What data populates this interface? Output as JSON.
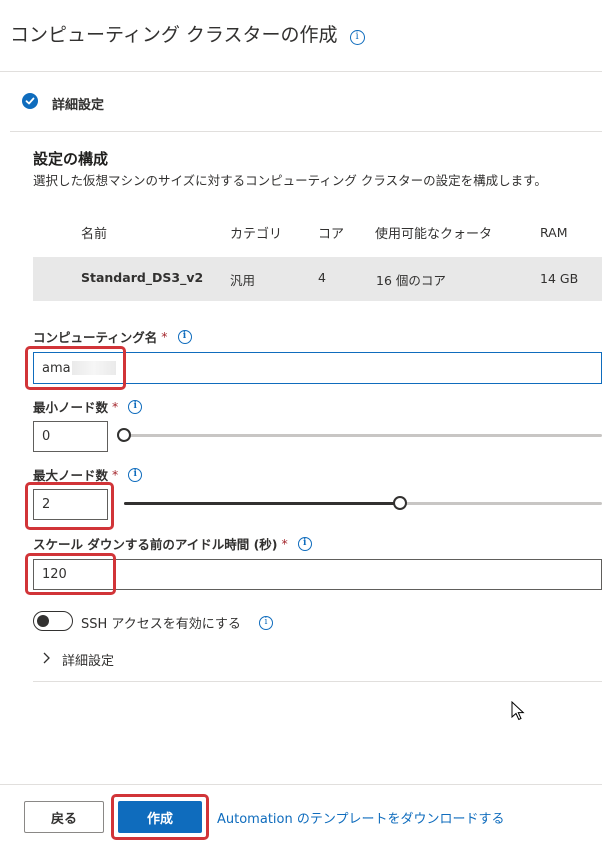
{
  "header": {
    "title": "コンピューティング クラスターの作成",
    "info_icon": "info-icon"
  },
  "step": {
    "label": "詳細設定",
    "status_icon": "checkmark-circle-icon"
  },
  "config": {
    "title": "設定の構成",
    "description": "選択した仮想マシンのサイズに対する設定を構成します。"
  },
  "vm_table": {
    "columns": [
      "名前",
      "カテゴリ",
      "コア",
      "使用可能なクォータ",
      "RAM"
    ],
    "row": [
      "Standard_DS3_v2",
      "汎用",
      "4",
      "16 個のコア",
      "14 GB"
    ]
  },
  "fields": {
    "compute_name": {
      "label": "コンピューティング名",
      "required": "*",
      "value": "ama"
    },
    "min_nodes": {
      "label": "最小ノード数",
      "required": "*",
      "value": "0",
      "slider_fraction": 0.0
    },
    "max_nodes": {
      "label": "最大ノード数",
      "required": "*",
      "value": "2",
      "slider_fraction": 0.58
    },
    "idle_time": {
      "label": "スケール ダウンする前のアイドル時間 (秒)",
      "required": "*",
      "value": "120"
    },
    "ssh": {
      "label": "SSH アクセスを有効にする",
      "enabled": false
    }
  },
  "advanced": {
    "label": "詳細設定",
    "icon": "chevron-right-icon"
  },
  "footer": {
    "back_label": "戻る",
    "create_label": "作成",
    "automation_link": "Automation のテンプレートをダウンロードする"
  },
  "colors": {
    "accent": "#0f6cbd",
    "highlight": "#d13438",
    "row_bg": "#e8e8e8"
  }
}
